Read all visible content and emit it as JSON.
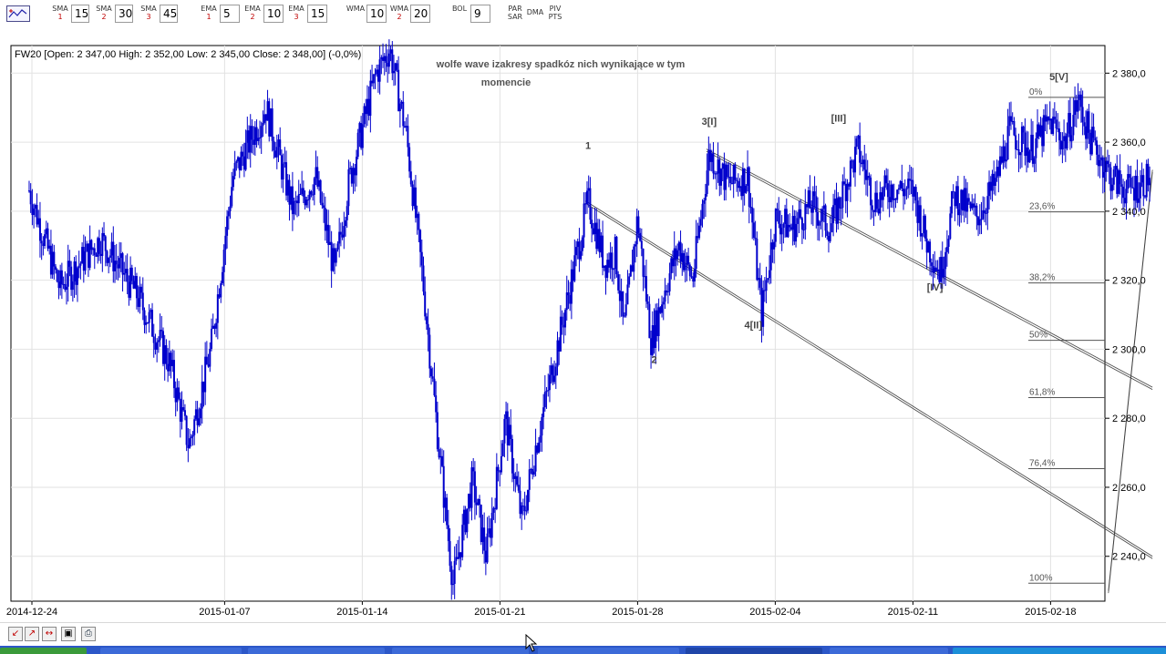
{
  "toolbar": {
    "chart_icon": "chart-type-icon",
    "indicators": [
      {
        "name": "SMA",
        "n": "1",
        "value": "15"
      },
      {
        "name": "SMA",
        "n": "2",
        "value": "30"
      },
      {
        "name": "SMA",
        "n": "3",
        "value": "45"
      },
      {
        "name": "EMA",
        "n": "1",
        "value": "5"
      },
      {
        "name": "EMA",
        "n": "2",
        "value": "10"
      },
      {
        "name": "EMA",
        "n": "3",
        "value": "15"
      },
      {
        "name": "WMA",
        "n": "",
        "value": "10"
      },
      {
        "name": "WMA",
        "n": "2",
        "value": "20"
      },
      {
        "name": "BOL",
        "n": "",
        "value": "9"
      }
    ],
    "buttons": [
      {
        "top": "PAR",
        "bottom": "SAR"
      },
      {
        "top": "DMA",
        "bottom": ""
      },
      {
        "top": "PIV",
        "bottom": "PTS"
      }
    ]
  },
  "chart_data": {
    "type": "candlestick",
    "info_line": "FW20 [Open: 2 347,00  High: 2 352,00  Low: 2 345,00  Close: 2 348,00] (-0,0%)",
    "annotation": [
      "wolfe wave izakresy spadkóz nich wynikające w tym",
      "momencie"
    ],
    "x_labels": [
      {
        "label": "2014-12-24",
        "x": 0
      },
      {
        "label": "2015-01-07",
        "x": 7
      },
      {
        "label": "2015-01-14",
        "x": 12
      },
      {
        "label": "2015-01-21",
        "x": 17
      },
      {
        "label": "2015-01-28",
        "x": 22
      },
      {
        "label": "2015-02-04",
        "x": 27
      },
      {
        "label": "2015-02-11",
        "x": 32
      },
      {
        "label": "2015-02-18",
        "x": 37
      }
    ],
    "ylim": [
      2227,
      2388
    ],
    "yticks": [
      {
        "value": 2380,
        "label": "2 380,0"
      },
      {
        "value": 2360,
        "label": "2 360,0"
      },
      {
        "value": 2340,
        "label": "2 340,0"
      },
      {
        "value": 2320,
        "label": "2 320,0"
      },
      {
        "value": 2300,
        "label": "2 300,0"
      },
      {
        "value": 2280,
        "label": "2 280,0"
      },
      {
        "value": 2260,
        "label": "2 260,0"
      },
      {
        "value": 2240,
        "label": "2 240,0"
      }
    ],
    "path": [
      [
        -0.1,
        2346
      ],
      [
        1.0,
        2318
      ],
      [
        2.5,
        2332
      ],
      [
        3.8,
        2316
      ],
      [
        5.0,
        2296
      ],
      [
        5.7,
        2272
      ],
      [
        6.5,
        2300
      ],
      [
        7.3,
        2350
      ],
      [
        8.5,
        2370
      ],
      [
        9.5,
        2340
      ],
      [
        10.3,
        2350
      ],
      [
        11.0,
        2322
      ],
      [
        11.5,
        2348
      ],
      [
        12.5,
        2380
      ],
      [
        13.0,
        2387
      ],
      [
        13.6,
        2362
      ],
      [
        14.2,
        2320
      ],
      [
        14.8,
        2270
      ],
      [
        15.3,
        2232
      ],
      [
        16.0,
        2262
      ],
      [
        16.5,
        2240
      ],
      [
        17.2,
        2280
      ],
      [
        17.8,
        2250
      ],
      [
        18.3,
        2272
      ],
      [
        19.2,
        2305
      ],
      [
        20.2,
        2343
      ],
      [
        20.8,
        2325
      ],
      [
        21.2,
        2328
      ],
      [
        21.5,
        2305
      ],
      [
        22.0,
        2338
      ],
      [
        22.5,
        2302
      ],
      [
        23.0,
        2318
      ],
      [
        23.5,
        2330
      ],
      [
        24.0,
        2320
      ],
      [
        24.6,
        2357
      ],
      [
        25.3,
        2348
      ],
      [
        26.0,
        2350
      ],
      [
        26.5,
        2310
      ],
      [
        27.0,
        2338
      ],
      [
        27.6,
        2335
      ],
      [
        28.3,
        2342
      ],
      [
        29.0,
        2335
      ],
      [
        30.0,
        2358
      ],
      [
        30.6,
        2343
      ],
      [
        31.2,
        2347
      ],
      [
        32.0,
        2346
      ],
      [
        32.5,
        2331
      ],
      [
        33.0,
        2322
      ],
      [
        33.5,
        2345
      ],
      [
        34.3,
        2338
      ],
      [
        35.0,
        2348
      ],
      [
        35.5,
        2363
      ],
      [
        36.3,
        2358
      ],
      [
        37.0,
        2366
      ],
      [
        37.5,
        2360
      ],
      [
        38.0,
        2372
      ],
      [
        38.5,
        2360
      ],
      [
        39.2,
        2350
      ],
      [
        39.8,
        2346
      ],
      [
        40.3,
        2348
      ],
      [
        40.6,
        2350
      ]
    ],
    "wave_labels": [
      {
        "text": "1",
        "x": 20.2,
        "y": 2358
      },
      {
        "text": "2",
        "x": 22.6,
        "y": 2296
      },
      {
        "text": "3[I]",
        "x": 24.6,
        "y": 2365
      },
      {
        "text": "4[II]",
        "x": 26.2,
        "y": 2306
      },
      {
        "text": "[III]",
        "x": 29.3,
        "y": 2366
      },
      {
        "text": "[IV]",
        "x": 32.8,
        "y": 2317
      },
      {
        "text": "5[V]",
        "x": 37.3,
        "y": 2378
      }
    ],
    "fibonacci": [
      {
        "label": "0%",
        "value": 2373.0
      },
      {
        "label": "23,6%",
        "value": 2339.8
      },
      {
        "label": "38,2%",
        "value": 2319.2
      },
      {
        "label": "50%",
        "value": 2302.6
      },
      {
        "label": "61,8%",
        "value": 2286.0
      },
      {
        "label": "76,4%",
        "value": 2265.4
      },
      {
        "label": "100%",
        "value": 2232.2
      }
    ],
    "trendlines": [
      {
        "from": [
          20.1,
          2343
        ],
        "to": [
          40.7,
          2240
        ]
      },
      {
        "from": [
          24.5,
          2358
        ],
        "to": [
          40.7,
          2289
        ]
      },
      {
        "from": [
          39.1,
          2230
        ],
        "to": [
          40.7,
          2352
        ]
      }
    ],
    "grid": true
  },
  "bottombar": {
    "buttons": [
      "zoom-in-icon",
      "zoom-out-icon",
      "zoom-range-icon",
      "fit-icon",
      "print-icon"
    ]
  }
}
